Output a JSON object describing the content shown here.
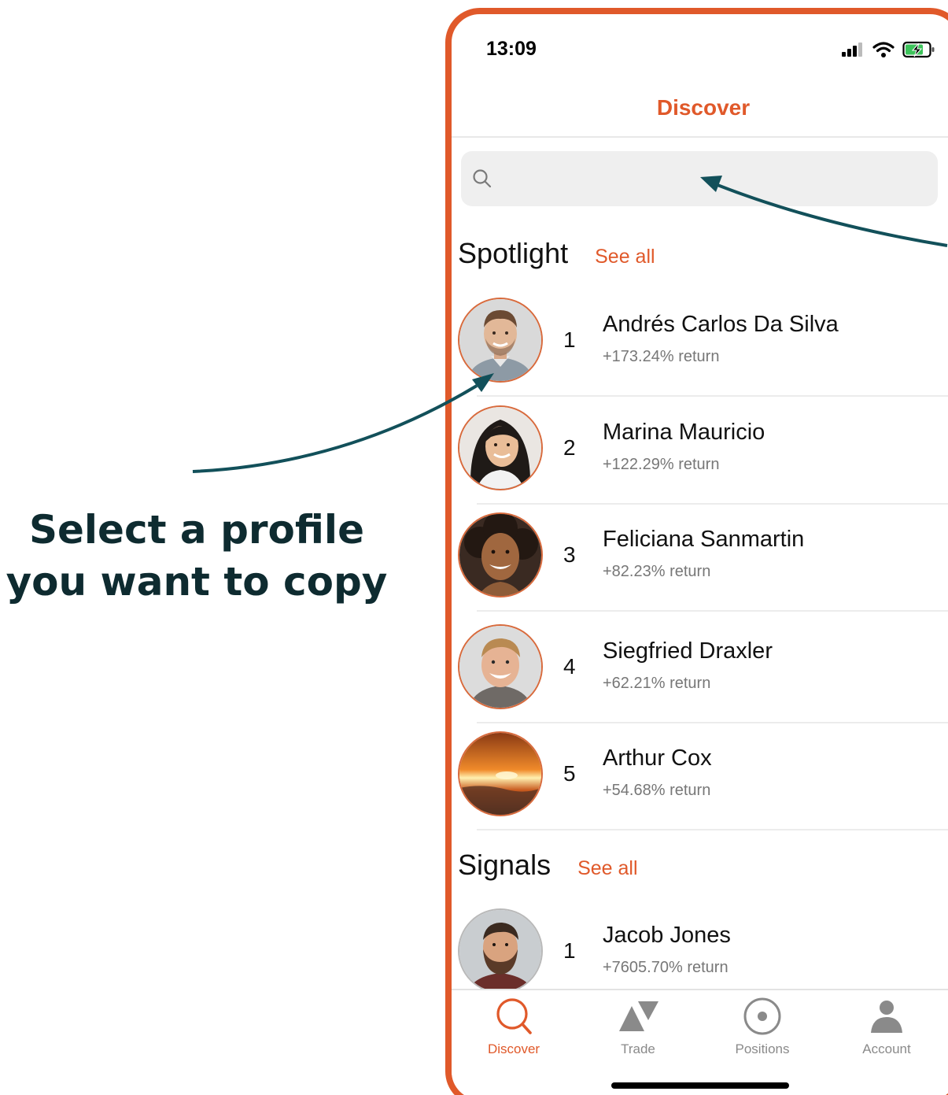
{
  "callout": {
    "line1": "Select a profile",
    "line2": "you want to copy"
  },
  "status": {
    "time": "13:09"
  },
  "nav": {
    "title": "Discover"
  },
  "search": {
    "placeholder": ""
  },
  "spotlight": {
    "title": "Spotlight",
    "see_all": "See all",
    "items": [
      {
        "rank": "1",
        "name": "Andrés Carlos Da Silva",
        "return": "+173.24% return"
      },
      {
        "rank": "2",
        "name": "Marina Mauricio",
        "return": "+122.29% return"
      },
      {
        "rank": "3",
        "name": "Feliciana Sanmartin",
        "return": "+82.23% return"
      },
      {
        "rank": "4",
        "name": "Siegfried Draxler",
        "return": "+62.21% return"
      },
      {
        "rank": "5",
        "name": "Arthur Cox",
        "return": "+54.68% return"
      }
    ]
  },
  "signals": {
    "title": "Signals",
    "see_all": "See all",
    "items": [
      {
        "rank": "1",
        "name": "Jacob Jones",
        "return": "+7605.70% return"
      }
    ]
  },
  "tabs": [
    {
      "label": "Discover",
      "icon": "search-icon",
      "active": true
    },
    {
      "label": "Trade",
      "icon": "trade-icon",
      "active": false
    },
    {
      "label": "Positions",
      "icon": "positions-icon",
      "active": false
    },
    {
      "label": "Account",
      "icon": "account-icon",
      "active": false
    }
  ],
  "colors": {
    "accent": "#e0592a",
    "callout_text": "#0e2b30",
    "arrow": "#12505a"
  }
}
